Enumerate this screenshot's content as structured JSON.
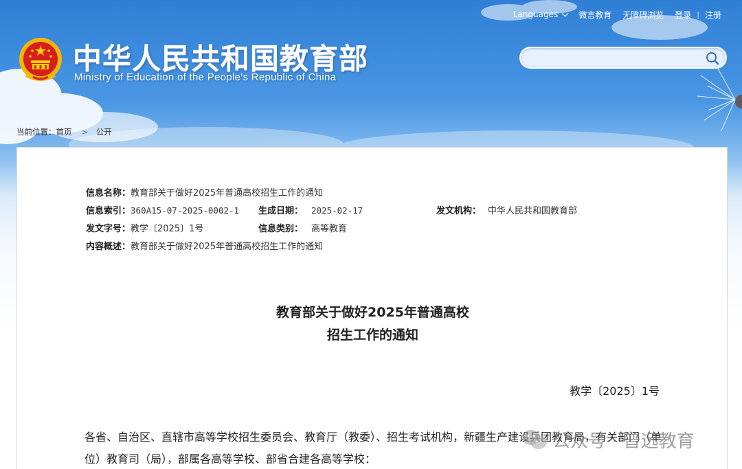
{
  "topbar": {
    "languages": "Languages",
    "weiyan": "微言教育",
    "accessible": "无障碍浏览",
    "login": "登录",
    "register": "注册"
  },
  "header": {
    "title_cn": "中华人民共和国教育部",
    "title_en": "Ministry of Education of the People's Republic of China"
  },
  "search": {
    "placeholder": ""
  },
  "breadcrumb": {
    "prefix": "当前位置：",
    "home": "首页",
    "current": "公开"
  },
  "meta": {
    "name_label": "信息名称：",
    "name_value": "教育部关于做好2025年普通高校招生工作的通知",
    "index_label": "信息索引：",
    "index_value": "360A15-07-2025-0002-1",
    "date_label": "生成日期：",
    "date_value": "2025-02-17",
    "org_label": "发文机构：",
    "org_value": "中华人民共和国教育部",
    "docno_label": "发文字号：",
    "docno_value": "教学〔2025〕1号",
    "category_label": "信息类别：",
    "category_value": "高等教育",
    "summary_label": "内容概述：",
    "summary_value": "教育部关于做好2025年普通高校招生工作的通知"
  },
  "document": {
    "title_line1": "教育部关于做好2025年普通高校",
    "title_line2": "招生工作的通知",
    "number": "教学〔2025〕1号",
    "para1": "各省、自治区、直辖市高等学校招生委员会、教育厅（教委）、招生考试机构，新疆生产建设兵团教育局，有关部门（单位）教育司（局），部属各高等学校、部省合建各高等学校："
  },
  "watermark": {
    "text": "公众号 · 普远教育"
  },
  "colors": {
    "sky": "#2f7fd6",
    "panel_border": "#d8d8d8",
    "text": "#222222"
  }
}
